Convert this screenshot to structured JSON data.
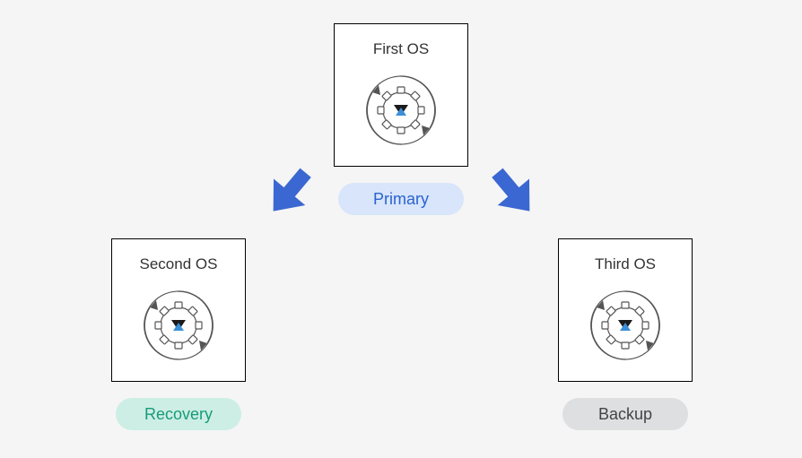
{
  "nodes": {
    "primary": {
      "title": "First OS",
      "badge": "Primary"
    },
    "recovery": {
      "title": "Second OS",
      "badge": "Recovery"
    },
    "backup": {
      "title": "Third OS",
      "badge": "Backup"
    }
  },
  "colors": {
    "arrow": "#3a67d1",
    "gear_stroke": "#555",
    "logo_dark": "#1a1a1a",
    "logo_blue": "#3a8fd8"
  }
}
